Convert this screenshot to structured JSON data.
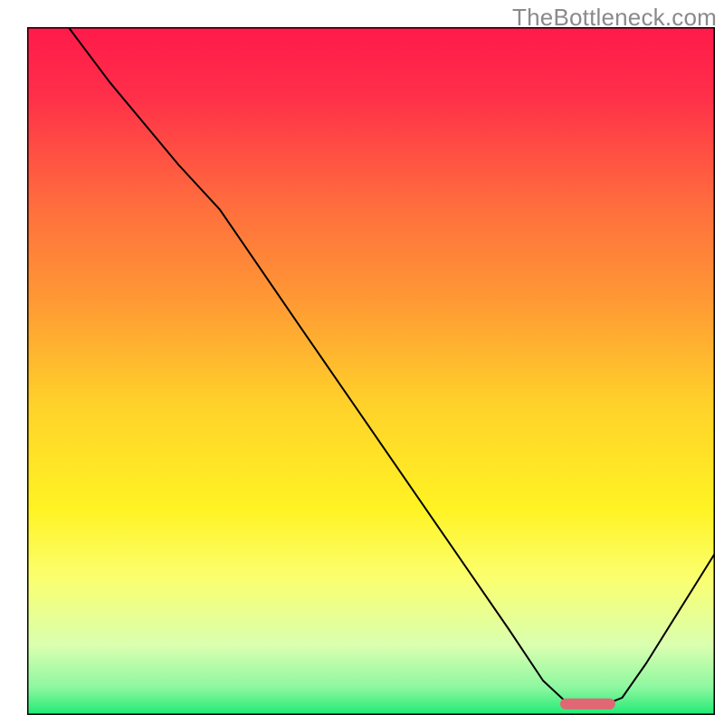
{
  "watermark": "TheBottleneck.com",
  "chart_data": {
    "type": "line",
    "title": "",
    "xlabel": "",
    "ylabel": "",
    "xlim": [
      0,
      100
    ],
    "ylim": [
      0,
      100
    ],
    "grid": false,
    "axes_visible": false,
    "background_gradient": {
      "stops": [
        {
          "offset": 0.0,
          "color": "#ff1a4b"
        },
        {
          "offset": 0.1,
          "color": "#ff2f49"
        },
        {
          "offset": 0.25,
          "color": "#ff6a3e"
        },
        {
          "offset": 0.4,
          "color": "#ff9a34"
        },
        {
          "offset": 0.55,
          "color": "#ffd22a"
        },
        {
          "offset": 0.7,
          "color": "#fff323"
        },
        {
          "offset": 0.8,
          "color": "#fbff6e"
        },
        {
          "offset": 0.9,
          "color": "#d9ffb0"
        },
        {
          "offset": 0.96,
          "color": "#8df7a0"
        },
        {
          "offset": 1.0,
          "color": "#1eea73"
        }
      ]
    },
    "series": [
      {
        "name": "curve",
        "color": "#000000",
        "stroke_width": 2,
        "points": [
          {
            "x": 6.0,
            "y": 100.0
          },
          {
            "x": 12.0,
            "y": 92.0
          },
          {
            "x": 22.0,
            "y": 80.0
          },
          {
            "x": 28.0,
            "y": 73.5
          },
          {
            "x": 40.0,
            "y": 56.0
          },
          {
            "x": 50.0,
            "y": 41.5
          },
          {
            "x": 60.0,
            "y": 27.0
          },
          {
            "x": 70.0,
            "y": 12.5
          },
          {
            "x": 75.0,
            "y": 5.0
          },
          {
            "x": 78.0,
            "y": 2.2
          },
          {
            "x": 80.0,
            "y": 1.5
          },
          {
            "x": 84.0,
            "y": 1.5
          },
          {
            "x": 86.5,
            "y": 2.5
          },
          {
            "x": 90.0,
            "y": 7.5
          },
          {
            "x": 95.0,
            "y": 15.5
          },
          {
            "x": 100.0,
            "y": 23.5
          }
        ]
      }
    ],
    "annotations": [
      {
        "name": "marker-band",
        "type": "rounded_rect",
        "color": "#e06875",
        "x_range": [
          77.5,
          85.5
        ],
        "y": 1.6,
        "height_frac": 0.016
      }
    ],
    "frame": {
      "color": "#000000",
      "width": 3
    }
  }
}
